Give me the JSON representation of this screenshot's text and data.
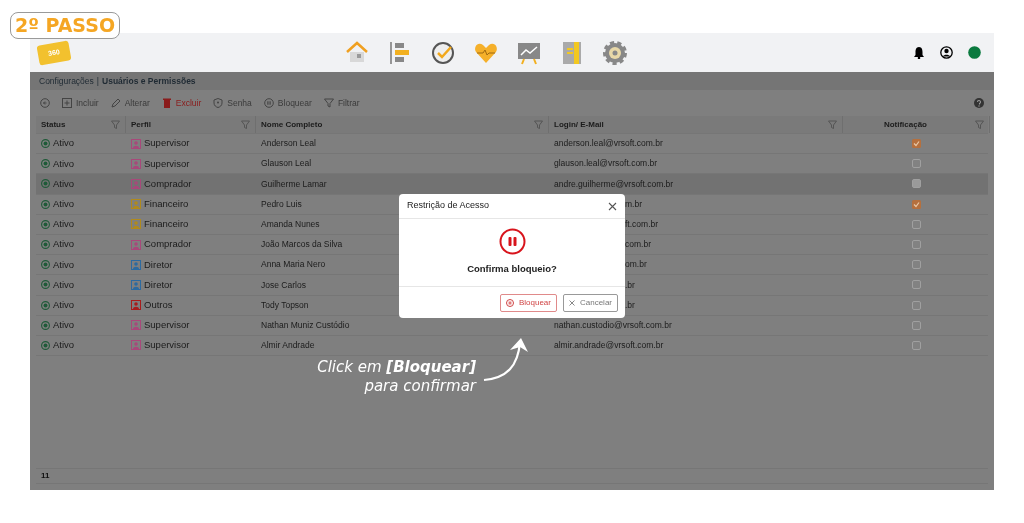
{
  "step_badge": "2º PASSO",
  "header": {
    "logo_text": "360"
  },
  "breadcrumb": {
    "parent": "Configurações",
    "separator": "|",
    "current": "Usuários e Permissões"
  },
  "toolbar": [
    {
      "label": "Incluir",
      "kind": "add",
      "danger": false
    },
    {
      "label": "Alterar",
      "kind": "edit",
      "danger": false
    },
    {
      "label": "Excluir",
      "kind": "delete",
      "danger": true
    },
    {
      "label": "Senha",
      "kind": "password",
      "danger": false
    },
    {
      "label": "Bloquear",
      "kind": "block",
      "danger": false
    },
    {
      "label": "Filtrar",
      "kind": "filter",
      "danger": false
    }
  ],
  "table": {
    "columns": [
      "Status",
      "Perfil",
      "Nome Completo",
      "Login/ E-Mail",
      "Notificação"
    ],
    "rows": [
      {
        "status": "Ativo",
        "profile": "Supervisor",
        "color": "#a8487a",
        "name": "Anderson Leal",
        "email": "anderson.leal@vrsoft.com.br",
        "notify": true,
        "selected": false
      },
      {
        "status": "Ativo",
        "profile": "Supervisor",
        "color": "#a8487a",
        "name": "Glauson Leal",
        "email": "glauson.leal@vrsoft.com.br",
        "notify": false,
        "selected": false
      },
      {
        "status": "Ativo",
        "profile": "Comprador",
        "color": "#a8487a",
        "name": "Guilherme Lamar",
        "email": "andre.guilherme@vrsoft.com.br",
        "notify": false,
        "selected": true
      },
      {
        "status": "Ativo",
        "profile": "Financeiro",
        "color": "#b08a1c",
        "name": "Pedro Luis",
        "email_tail": "m.br",
        "notify": true,
        "selected": false
      },
      {
        "status": "Ativo",
        "profile": "Financeiro",
        "color": "#b08a1c",
        "name": "Amanda Nunes",
        "email_tail": "ft.com.br",
        "notify": false,
        "selected": false
      },
      {
        "status": "Ativo",
        "profile": "Comprador",
        "color": "#a8487a",
        "name": "João Marcos da Silva",
        "email_tail": "com.br",
        "notify": false,
        "selected": false
      },
      {
        "status": "Ativo",
        "profile": "Diretor",
        "color": "#2c6aa0",
        "name": "Anna Maria Nero",
        "email_tail": "om.br",
        "notify": false,
        "selected": false
      },
      {
        "status": "Ativo",
        "profile": "Diretor",
        "color": "#2c6aa0",
        "name": "Jose Carlos",
        "email_tail": ".br",
        "notify": false,
        "selected": false
      },
      {
        "status": "Ativo",
        "profile": "Outros",
        "color": "#a81c1c",
        "name": "Tody Topson",
        "email_tail": ".br",
        "notify": false,
        "selected": false
      },
      {
        "status": "Ativo",
        "profile": "Supervisor",
        "color": "#a8487a",
        "name": "Nathan Muniz Custódio",
        "email": "nathan.custodio@vrsoft.com.br",
        "notify": false,
        "selected": false
      },
      {
        "status": "Ativo",
        "profile": "Supervisor",
        "color": "#a8487a",
        "name": "Almir Andrade",
        "email": "almir.andrade@vrsoft.com.br",
        "notify": false,
        "selected": false
      }
    ],
    "footer_count": "11"
  },
  "modal": {
    "title": "Restrição de Acesso",
    "message": "Confirma bloqueio?",
    "buttons": [
      {
        "label": "Bloquear",
        "kind": "confirm"
      },
      {
        "label": "Cancelar",
        "kind": "cancel"
      }
    ]
  },
  "annotation": {
    "line1": "Click em **[Bloquear]**",
    "line2": "para confirmar"
  }
}
